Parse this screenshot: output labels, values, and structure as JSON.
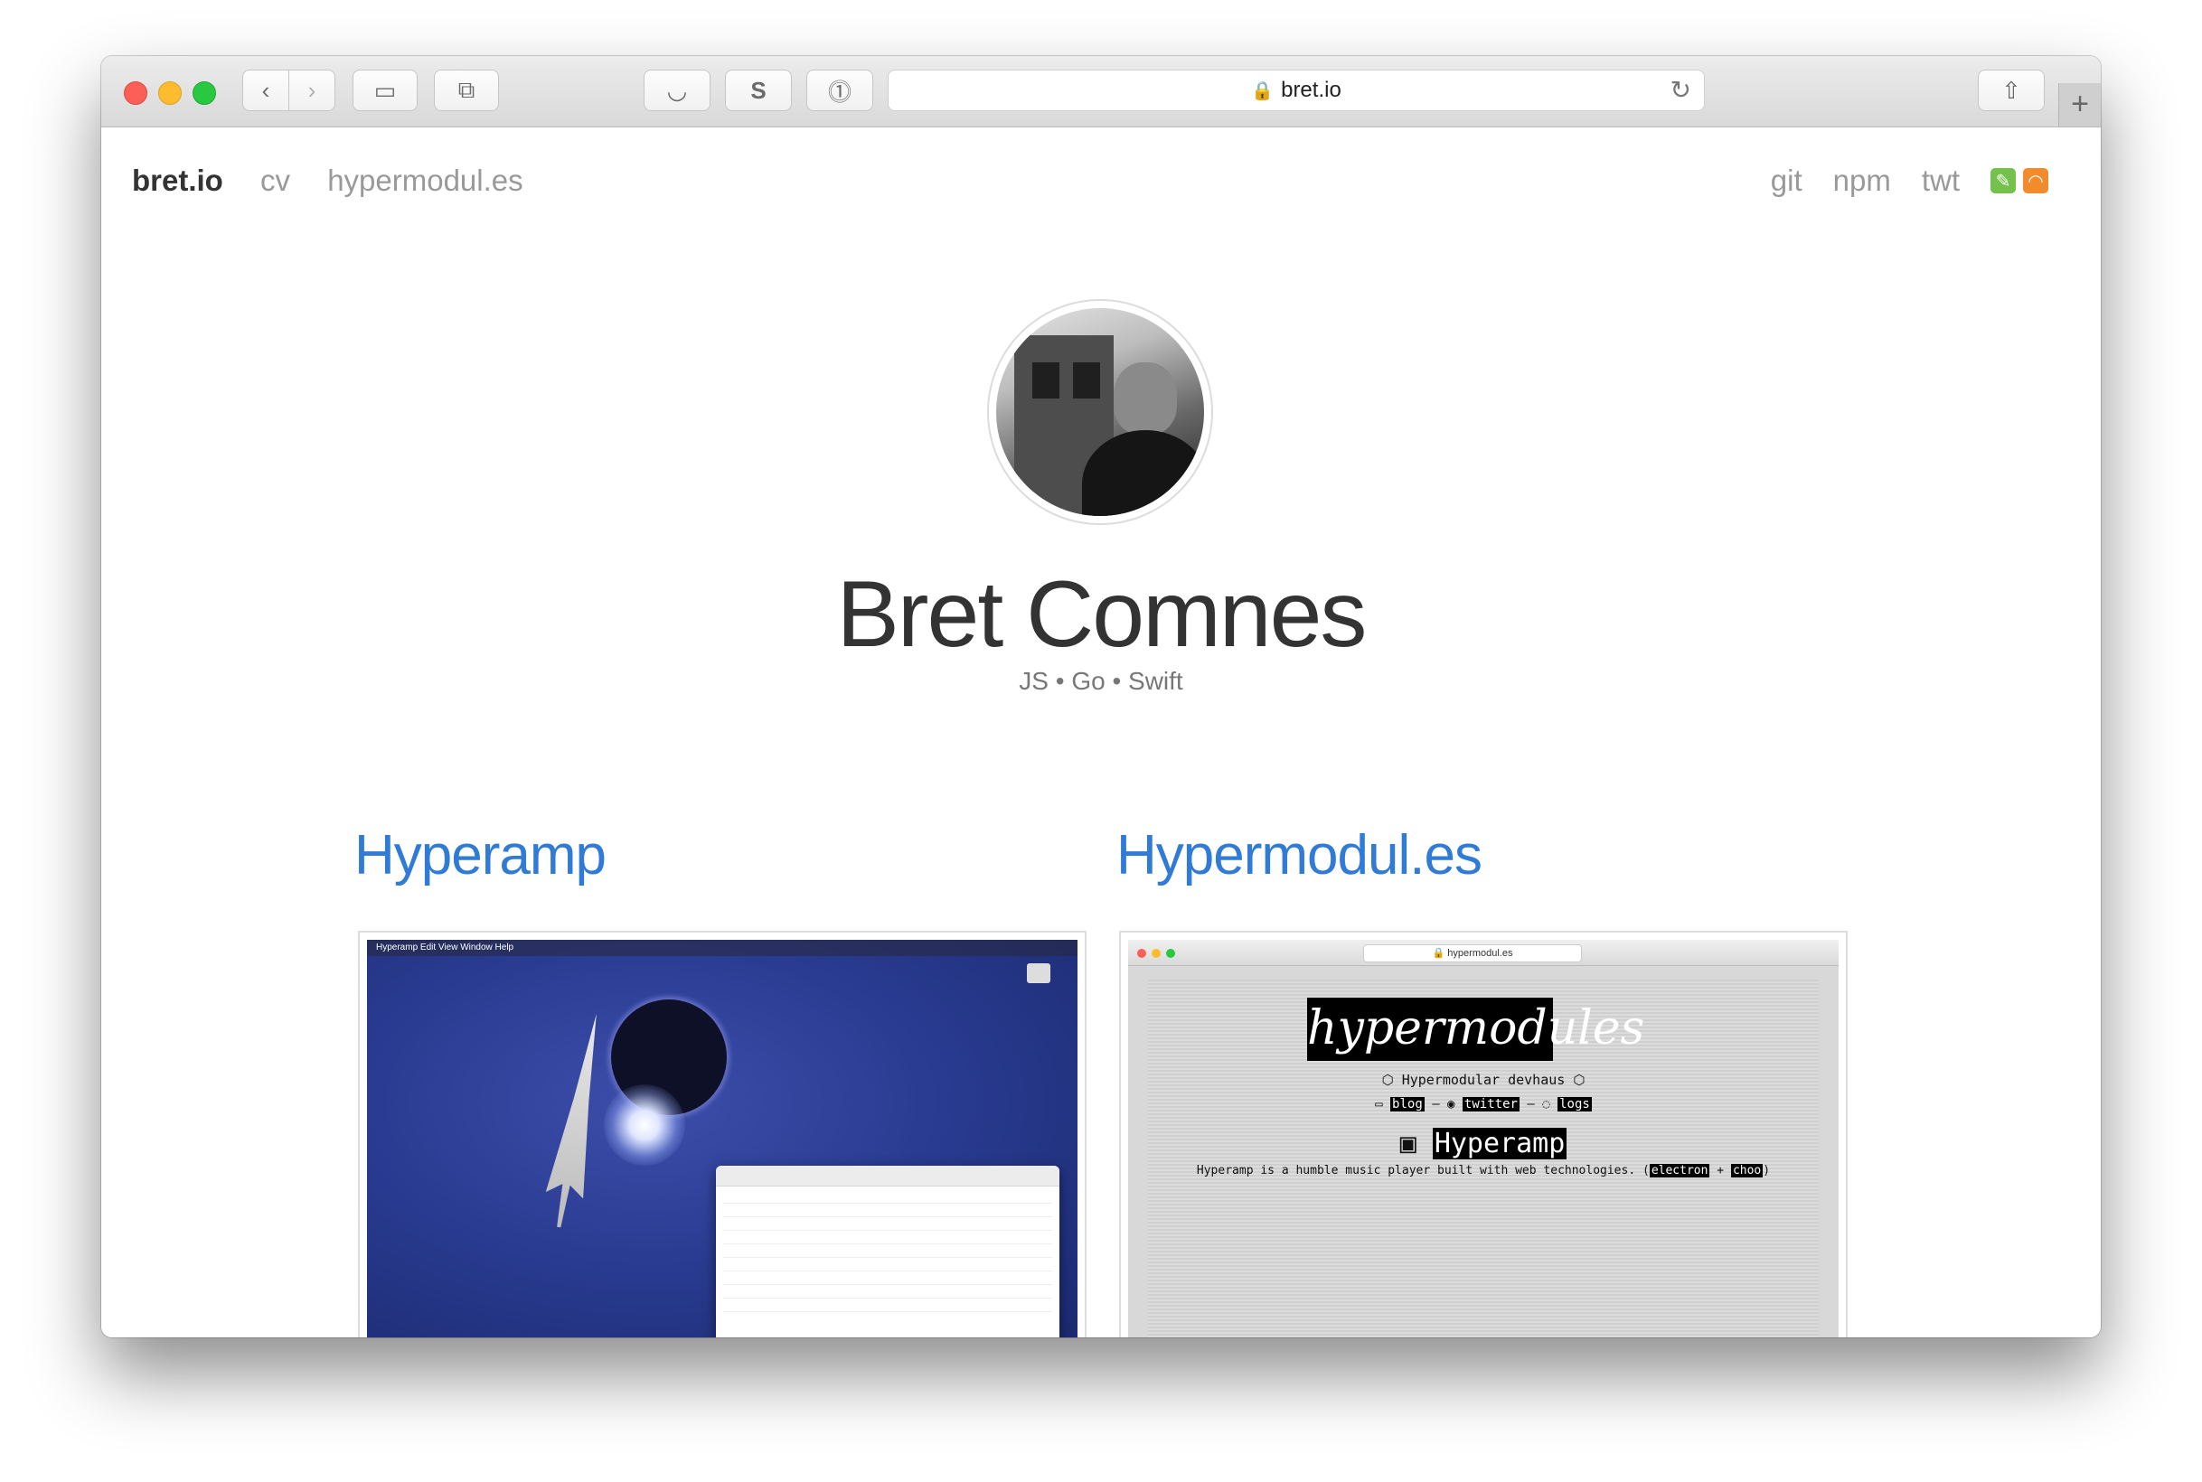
{
  "browser": {
    "url": "bret.io",
    "toolbar_icons": [
      "back-icon",
      "forward-icon",
      "sidebar-icon",
      "tabs-icon",
      "shield-icon",
      "s-extension-icon",
      "password-icon",
      "share-icon",
      "new-tab-icon"
    ]
  },
  "nav": {
    "brand": "bret.io",
    "left_links": [
      "cv",
      "hypermodul.es"
    ],
    "right_links": [
      "git",
      "npm",
      "twt"
    ]
  },
  "profile": {
    "name": "Bret Comnes",
    "tagline": "JS • Go • Swift"
  },
  "projects": [
    {
      "title": "Hyperamp",
      "screenshot": {
        "menu": " Hyperamp   Edit   View   Window   Help"
      }
    },
    {
      "title": "Hypermodul.es",
      "screenshot": {
        "url": "🔒 hypermodul.es",
        "logo": "hypermodules",
        "subtitle": "⬡ Hypermodular devhaus ⬡",
        "link_blog": "blog",
        "link_twitter": "twitter",
        "link_logs": "logs",
        "heading": "Hyperamp",
        "description": "Hyperamp is a humble music player built with web technologies.",
        "tag_electron": "electron",
        "tag_choo": "choo"
      }
    }
  ],
  "colors": {
    "link_blue": "#2f7bd6",
    "nav_gray": "#999999"
  }
}
